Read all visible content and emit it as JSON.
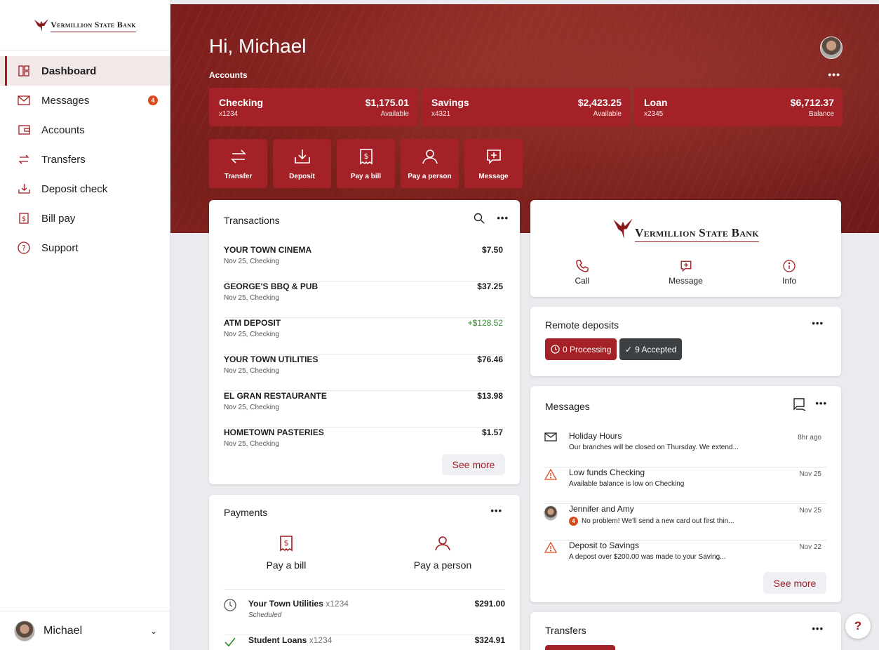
{
  "brand": {
    "name": "Vermillion State Bank",
    "accent": "#a42127"
  },
  "sidebar": {
    "items": [
      {
        "label": "Dashboard",
        "icon": "dashboard-icon",
        "active": true
      },
      {
        "label": "Messages",
        "icon": "envelope-icon",
        "badge": "4"
      },
      {
        "label": "Accounts",
        "icon": "wallet-icon"
      },
      {
        "label": "Transfers",
        "icon": "transfer-icon"
      },
      {
        "label": "Deposit check",
        "icon": "deposit-icon"
      },
      {
        "label": "Bill pay",
        "icon": "bill-icon"
      },
      {
        "label": "Support",
        "icon": "help-circle-icon"
      }
    ],
    "user": {
      "name": "Michael"
    }
  },
  "hero": {
    "greeting": "Hi, Michael",
    "accounts_label": "Accounts",
    "accounts": [
      {
        "name": "Checking",
        "number": "x1234",
        "balance": "$1,175.01",
        "balance_label": "Available"
      },
      {
        "name": "Savings",
        "number": "x4321",
        "balance": "$2,423.25",
        "balance_label": "Available"
      },
      {
        "name": "Loan",
        "number": "x2345",
        "balance": "$6,712.37",
        "balance_label": "Balance"
      }
    ],
    "actions": [
      {
        "label": "Transfer",
        "icon": "transfer-icon"
      },
      {
        "label": "Deposit",
        "icon": "deposit-icon"
      },
      {
        "label": "Pay a bill",
        "icon": "bill-icon"
      },
      {
        "label": "Pay a person",
        "icon": "person-icon"
      },
      {
        "label": "Message",
        "icon": "message-plus-icon"
      }
    ]
  },
  "transactions": {
    "title": "Transactions",
    "rows": [
      {
        "name": "YOUR TOWN CINEMA",
        "date": "Nov 25, Checking",
        "amount": "$7.50"
      },
      {
        "name": "GEORGE'S BBQ & PUB",
        "date": "Nov 25, Checking",
        "amount": "$37.25"
      },
      {
        "name": "ATM DEPOSIT",
        "date": "Nov 25, Checking",
        "amount": "+$128.52",
        "positive": true
      },
      {
        "name": "YOUR TOWN UTILITIES",
        "date": "Nov 25, Checking",
        "amount": "$76.46"
      },
      {
        "name": "EL GRAN RESTAURANTE",
        "date": "Nov 25, Checking",
        "amount": "$13.98"
      },
      {
        "name": "HOMETOWN PASTERIES",
        "date": "Nov 25, Checking",
        "amount": "$1.57"
      }
    ],
    "see_more": "See more"
  },
  "payments": {
    "title": "Payments",
    "options": [
      {
        "label": "Pay a bill",
        "icon": "bill-icon"
      },
      {
        "label": "Pay a person",
        "icon": "person-icon"
      }
    ],
    "rows": [
      {
        "name": "Your Town Utilities",
        "acct": "x1234",
        "status": "Scheduled",
        "amount": "$291.00",
        "icon": "clock-icon"
      },
      {
        "name": "Student Loans",
        "acct": "x1234",
        "status": "",
        "amount": "$324.91",
        "icon": "check-icon"
      }
    ]
  },
  "bank_card": {
    "logo": "Vermillion State Bank",
    "actions": [
      {
        "label": "Call",
        "icon": "phone-icon"
      },
      {
        "label": "Message",
        "icon": "message-plus-icon"
      },
      {
        "label": "Info",
        "icon": "info-icon"
      }
    ]
  },
  "remote_deposits": {
    "title": "Remote deposits",
    "processing": "0 Processing",
    "accepted": "9 Accepted"
  },
  "messages": {
    "title": "Messages",
    "rows": [
      {
        "subject": "Holiday Hours",
        "preview": "Our branches will be closed on Thursday. We extend...",
        "time": "8hr ago",
        "icon": "envelope-icon"
      },
      {
        "subject": "Low funds Checking",
        "preview": "Available balance is low on Checking",
        "time": "Nov 25",
        "icon": "warning-icon"
      },
      {
        "subject": "Jennifer and Amy",
        "preview": "No problem! We'll send a new card out first thin...",
        "time": "Nov 25",
        "icon": "avatar",
        "badge": "4"
      },
      {
        "subject": "Deposit to Savings",
        "preview": "A depost over $200.00 was made to your Saving...",
        "time": "Nov 22",
        "icon": "warning-icon"
      }
    ],
    "see_more": "See more"
  },
  "transfers": {
    "title": "Transfers"
  },
  "help": {
    "label": "?"
  }
}
